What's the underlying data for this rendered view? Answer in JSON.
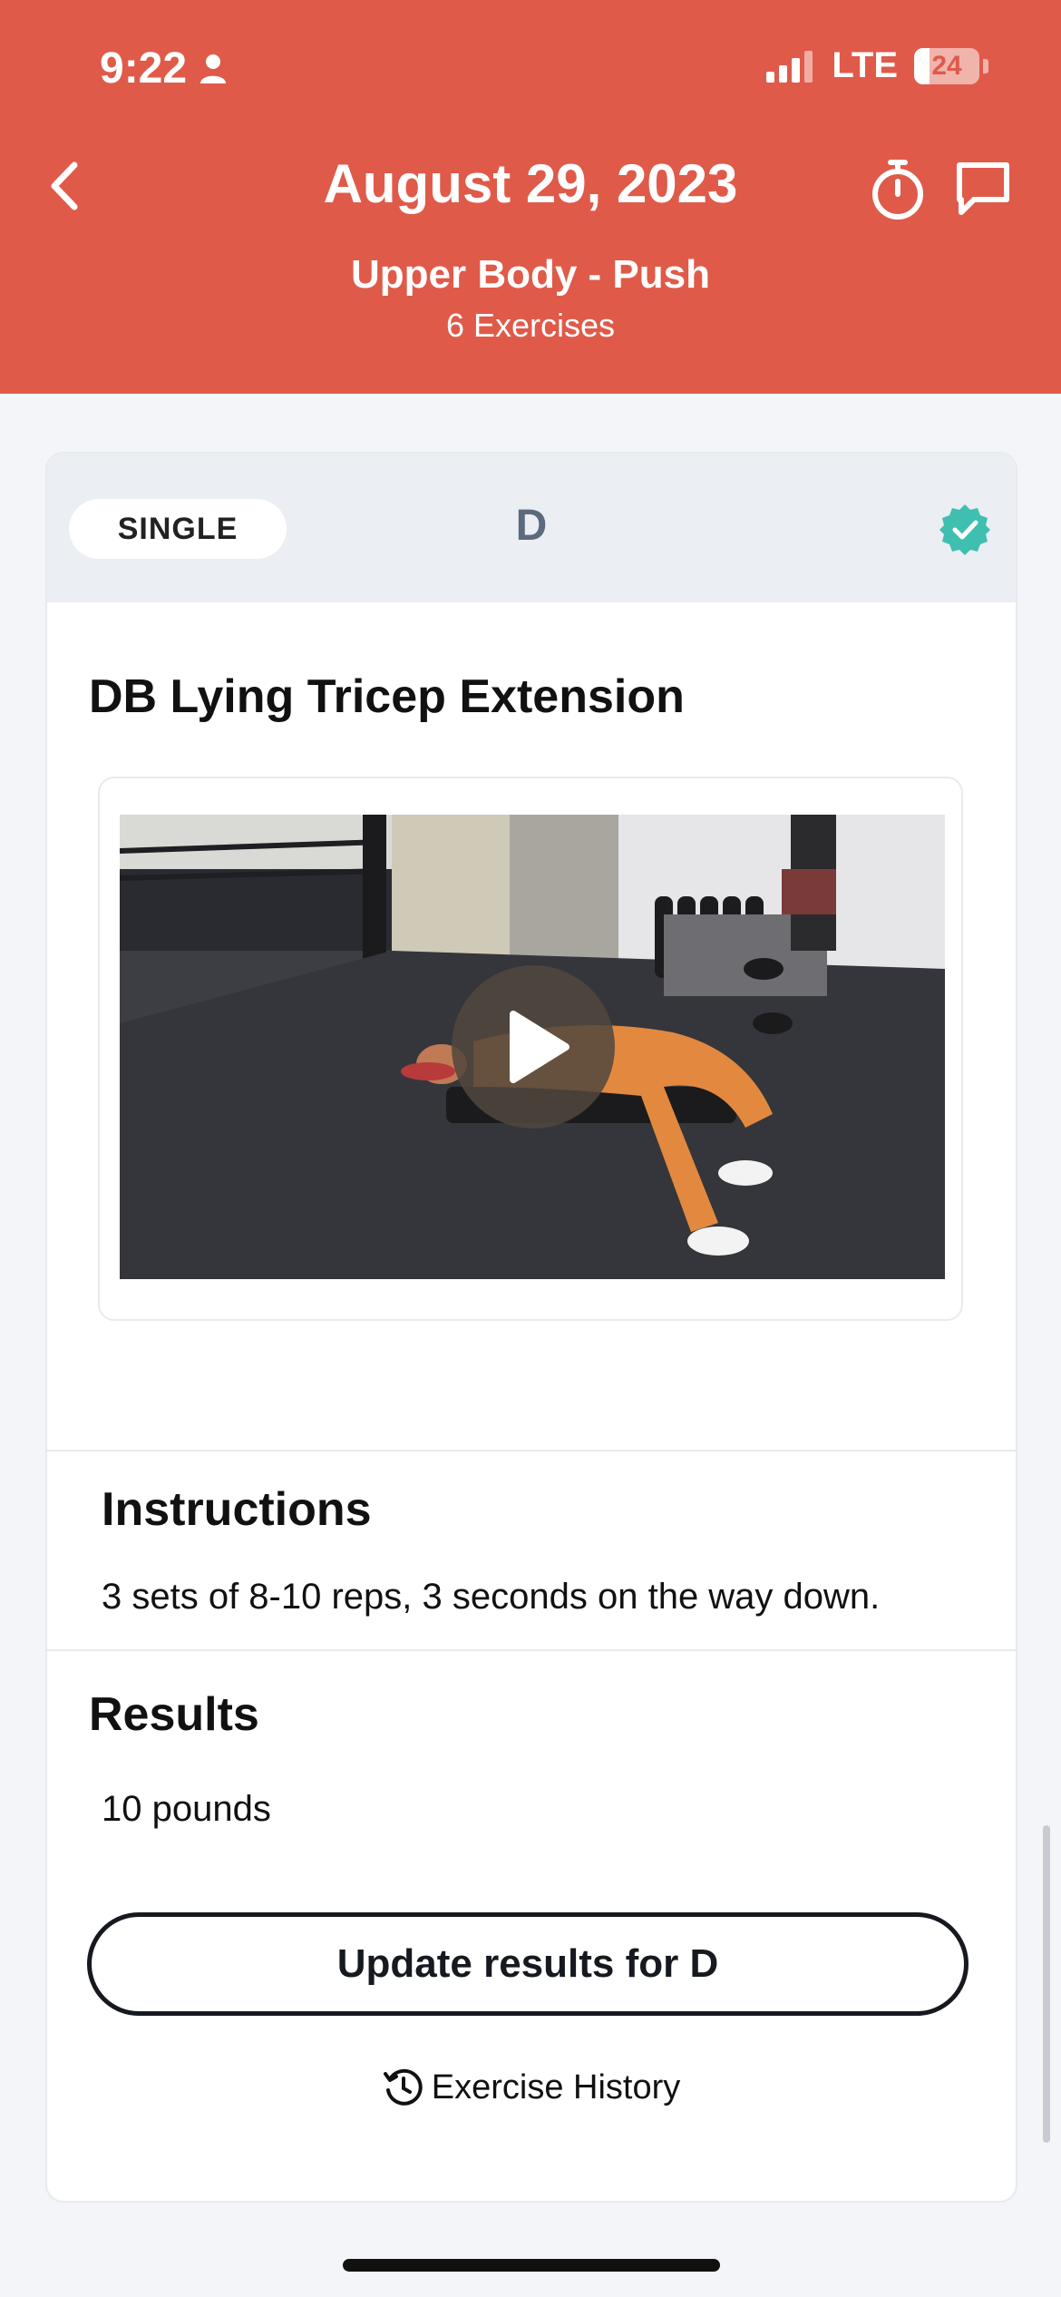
{
  "status_bar": {
    "time": "9:22",
    "network": "LTE",
    "battery": "24"
  },
  "header": {
    "title": "August 29, 2023",
    "workout_name": "Upper Body - Push",
    "exercise_count": "6 Exercises",
    "icons": [
      "back-chevron-icon",
      "stopwatch-icon",
      "chat-bubble-icon"
    ]
  },
  "exercise_card": {
    "type_badge": "SINGLE",
    "letter": "D",
    "completed": true,
    "exercise_name": "DB Lying Tricep Extension",
    "video_icon": "play-icon",
    "instructions_heading": "Instructions",
    "instructions_text": "3 sets of 8-10 reps, 3 seconds on the way down.",
    "results_heading": "Results",
    "results_value": "10 pounds",
    "update_button": "Update results for D",
    "history_link": "Exercise History"
  },
  "colors": {
    "header": "#e05a49",
    "check": "#3fbfb0",
    "background": "#f3f5f8"
  }
}
